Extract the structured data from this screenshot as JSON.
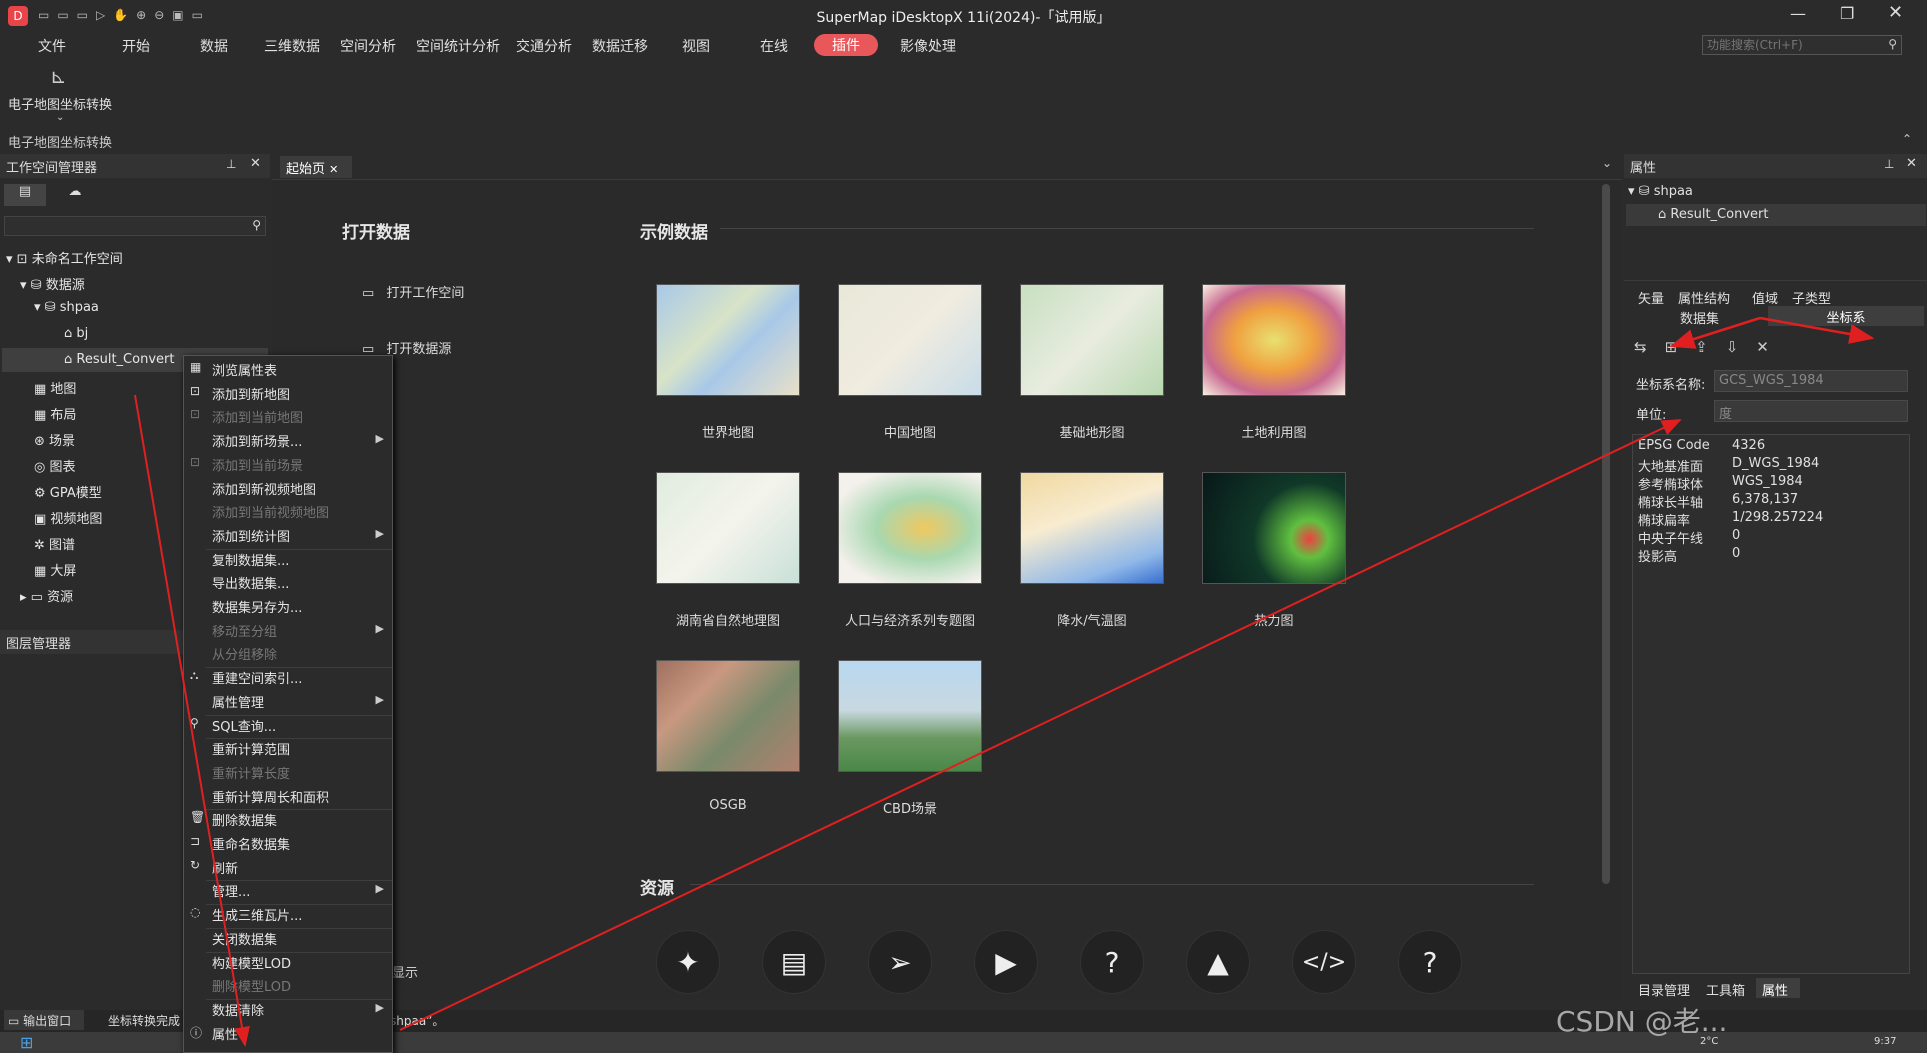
{
  "app": {
    "title": "SuperMap iDesktopX 11i(2024)-「试用版」"
  },
  "menu": [
    "文件",
    "开始",
    "数据",
    "三维数据",
    "空间分析",
    "空间统计分析",
    "交通分析",
    "数据迁移",
    "视图",
    "在线",
    "插件",
    "影像处理"
  ],
  "search": {
    "placeholder": "功能搜索(Ctrl+F)"
  },
  "ribbon": {
    "button_label": "电子地图坐标转换",
    "group_label": "电子地图坐标转换"
  },
  "workspace": {
    "title": "工作空间管理器",
    "root": "未命名工作空间",
    "datasources": "数据源",
    "ds_name": "shpaa",
    "ds_items": [
      "bj",
      "Result_Convert"
    ],
    "nodes": [
      "地图",
      "布局",
      "场景",
      "图表",
      "GPA模型",
      "视频地图",
      "图谱",
      "大屏",
      "资源"
    ]
  },
  "layer_manager": {
    "title": "图层管理器"
  },
  "center": {
    "tab": "起始页",
    "open_data_title": "打开数据",
    "open_workspace": "打开工作空间",
    "open_datasource": "打开数据源",
    "sample_title": "示例数据",
    "samples": [
      "世界地图",
      "中国地图",
      "基础地形图",
      "土地利用图",
      "湖南省自然地理图",
      "人口与经济系列专题图",
      "降水/气温图",
      "热力图",
      "OSGB",
      "CBD场景"
    ],
    "resources_title": "资源",
    "partial_text": "显示",
    "partial_status": "shpaa”。"
  },
  "context_menu": [
    {
      "label": "浏览属性表",
      "enabled": true,
      "sub": false
    },
    {
      "label": "添加到新地图",
      "enabled": true,
      "sub": false
    },
    {
      "label": "添加到当前地图",
      "enabled": false,
      "sub": false
    },
    {
      "label": "添加到新场景...",
      "enabled": true,
      "sub": true
    },
    {
      "label": "添加到当前场景",
      "enabled": false,
      "sub": false
    },
    {
      "label": "添加到新视频地图",
      "enabled": true,
      "sub": false
    },
    {
      "label": "添加到当前视频地图",
      "enabled": false,
      "sub": false
    },
    {
      "label": "添加到统计图",
      "enabled": true,
      "sub": true
    },
    {
      "label": "复制数据集...",
      "enabled": true,
      "sub": false
    },
    {
      "label": "导出数据集...",
      "enabled": true,
      "sub": false
    },
    {
      "label": "数据集另存为...",
      "enabled": true,
      "sub": false
    },
    {
      "label": "移动至分组",
      "enabled": false,
      "sub": true
    },
    {
      "label": "从分组移除",
      "enabled": false,
      "sub": false
    },
    {
      "label": "重建空间索引...",
      "enabled": true,
      "sub": false
    },
    {
      "label": "属性管理",
      "enabled": true,
      "sub": true
    },
    {
      "label": "SQL查询...",
      "enabled": true,
      "sub": false
    },
    {
      "label": "重新计算范围",
      "enabled": true,
      "sub": false
    },
    {
      "label": "重新计算长度",
      "enabled": false,
      "sub": false
    },
    {
      "label": "重新计算周长和面积",
      "enabled": true,
      "sub": false
    },
    {
      "label": "删除数据集",
      "enabled": true,
      "sub": false
    },
    {
      "label": "重命名数据集",
      "enabled": true,
      "sub": false
    },
    {
      "label": "刷新",
      "enabled": true,
      "sub": false
    },
    {
      "label": "管理...",
      "enabled": true,
      "sub": true
    },
    {
      "label": "生成三维瓦片...",
      "enabled": true,
      "sub": false
    },
    {
      "label": "关闭数据集",
      "enabled": true,
      "sub": false
    },
    {
      "label": "构建模型LOD",
      "enabled": true,
      "sub": false
    },
    {
      "label": "删除模型LOD",
      "enabled": false,
      "sub": false
    },
    {
      "label": "数据清除",
      "enabled": true,
      "sub": true
    },
    {
      "label": "属性",
      "enabled": true,
      "sub": false
    }
  ],
  "properties": {
    "title": "属性",
    "ds_name": "shpaa",
    "dataset": "Result_Convert",
    "tabs_row1": [
      "矢量",
      "属性结构",
      "值域",
      "子类型"
    ],
    "tabs_row2": [
      "数据集",
      "坐标系"
    ],
    "coord_name_label": "坐标系名称:",
    "coord_name_value": "GCS_WGS_1984",
    "unit_label": "单位:",
    "unit_value": "度",
    "info": [
      {
        "k": "EPSG Code",
        "v": "4326"
      },
      {
        "k": "大地基准面",
        "v": "D_WGS_1984"
      },
      {
        "k": "参考椭球体",
        "v": "WGS_1984"
      },
      {
        "k": "椭球长半轴",
        "v": "6,378,137"
      },
      {
        "k": "椭球扁率",
        "v": "1/298.257224"
      },
      {
        "k": "中央子午线",
        "v": "0"
      },
      {
        "k": "投影高",
        "v": "0"
      }
    ],
    "bottom_tabs": [
      "目录管理",
      "工具箱",
      "属性"
    ]
  },
  "status": {
    "output": "输出窗口",
    "message": "坐标转换完成"
  },
  "taskbar": {
    "temp": "2°C",
    "time": "9:37"
  },
  "watermark": "CSDN @老..."
}
